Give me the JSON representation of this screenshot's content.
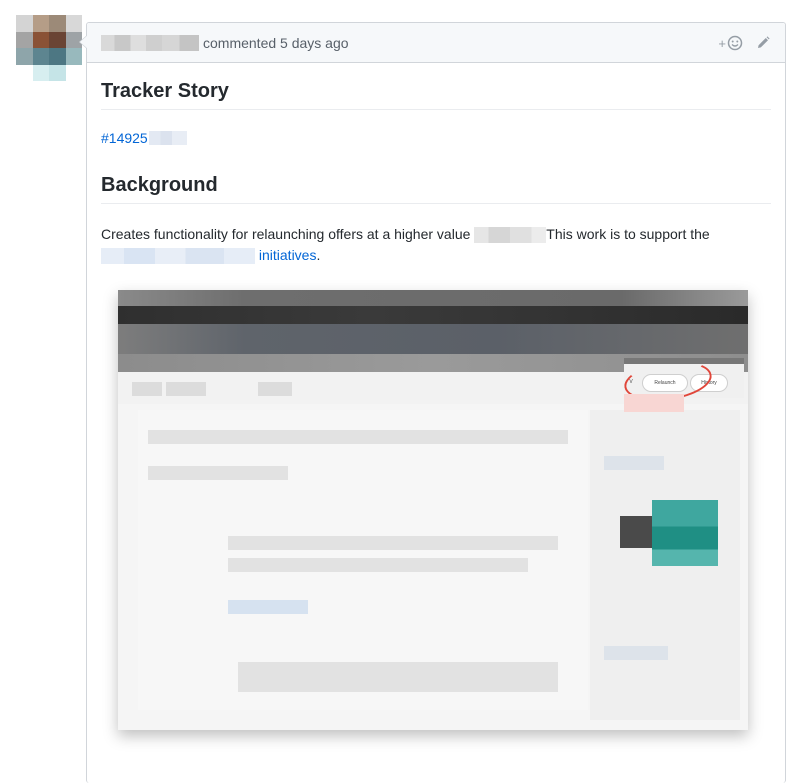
{
  "comment": {
    "action_text": "commented 5 days ago",
    "add_reaction": "+",
    "icons": {
      "reaction": "smiley-icon",
      "edit": "pencil-icon"
    },
    "heading_tracker": "Tracker Story",
    "issue_link_prefix": "#14925",
    "heading_background": "Background",
    "paragraph": {
      "part1": "Creates functionality for relaunching offers at a higher value ",
      "part2": "This work is to support the ",
      "link_text": "initiatives",
      "end": "."
    },
    "embedded_screenshot": {
      "buttons": [
        "V",
        "Relaunch",
        "History"
      ]
    }
  },
  "colors": {
    "link": "#0366d6",
    "border": "#d1d5da",
    "header_bg": "#f6f8fa",
    "highlight_circle": "#e0463a",
    "teal": "#1f8f84"
  }
}
